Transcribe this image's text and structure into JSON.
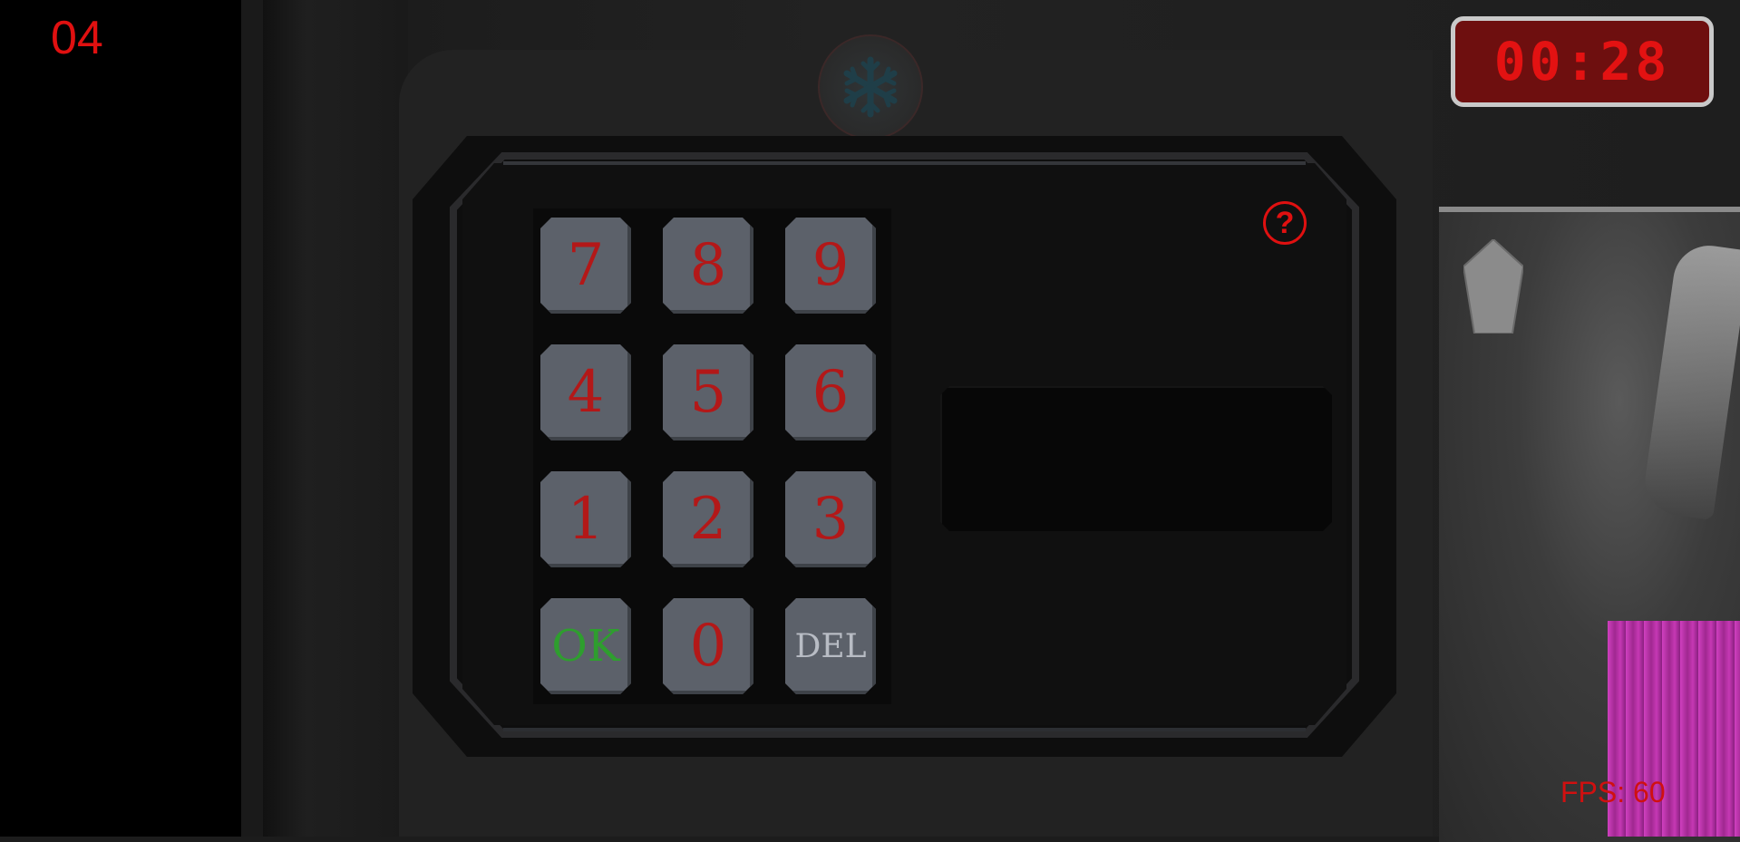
{
  "level": "04",
  "timer": "00:28",
  "fps": "FPS: 60",
  "keypad": {
    "keys": [
      "7",
      "8",
      "9",
      "4",
      "5",
      "6",
      "1",
      "2",
      "3",
      "OK",
      "0",
      "DEL"
    ]
  },
  "display": {
    "value": ""
  },
  "help_symbol": "?",
  "colors": {
    "accent_red": "#e01010",
    "ok_green": "#2e9e2e",
    "key_face": "#5c616a",
    "timer_bg": "#6e0f0f"
  },
  "icons": [
    "snowflake-icon",
    "help-icon",
    "pentagon-icon"
  ]
}
